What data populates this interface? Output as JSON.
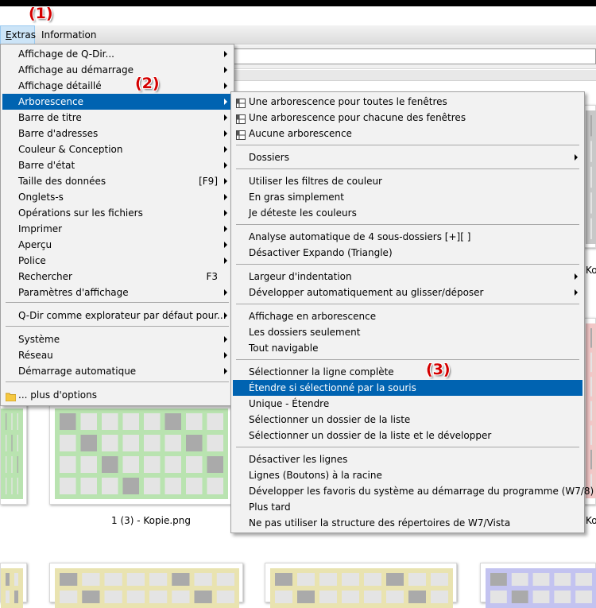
{
  "menubar": {
    "extras_underlined": "E",
    "extras_rest": "xtras",
    "information": "Information"
  },
  "callouts": [
    "(1)",
    "(2)",
    "(3)"
  ],
  "captions": [
    "1 (3) - Kopie.png",
    "Ko",
    "Ko"
  ],
  "extras_menu": {
    "items": [
      {
        "label": "Affichage de Q-Dir...",
        "submenu": true
      },
      {
        "label": "Affichage au démarrage",
        "submenu": true
      },
      {
        "label": "Affichage détaillé",
        "submenu": true
      },
      {
        "label": "Arborescence",
        "submenu": true,
        "highlighted": true
      },
      {
        "label": "Barre de titre",
        "submenu": true
      },
      {
        "label": "Barre d'adresses",
        "submenu": true
      },
      {
        "label": "Couleur & Conception",
        "submenu": true
      },
      {
        "label": "Barre d'état",
        "submenu": true
      },
      {
        "label": "Taille des données",
        "shortcut": "[F9]",
        "submenu": true
      },
      {
        "label": "Onglets-s",
        "submenu": true
      },
      {
        "label": "Opérations sur les fichiers",
        "submenu": true
      },
      {
        "label": "Imprimer",
        "submenu": true
      },
      {
        "label": "Aperçu",
        "submenu": true
      },
      {
        "label": "Police",
        "submenu": true
      },
      {
        "label": "Rechercher",
        "shortcut": "F3"
      },
      {
        "label": "Paramètres d'affichage",
        "submenu": true
      },
      {
        "label": "Q-Dir comme explorateur par défaut pour...",
        "submenu": true
      },
      {
        "label": "Système",
        "submenu": true
      },
      {
        "label": "Réseau",
        "submenu": true
      },
      {
        "label": "Démarrage automatique",
        "submenu": true
      },
      {
        "label": "... plus d'options",
        "icon": "folder-icon"
      }
    ]
  },
  "tree_menu": {
    "items": [
      {
        "label": "Une arborescence pour toutes le fenêtres",
        "icon": "layout-grid-icon"
      },
      {
        "label": "Une arborescence pour chacune des fenêtres",
        "icon": "layout-grid-icon"
      },
      {
        "label": "Aucune arborescence",
        "icon": "layout-grid-icon"
      },
      {
        "label": "Dossiers",
        "submenu": true
      },
      {
        "label": "Utiliser les filtres de couleur"
      },
      {
        "label": "En gras simplement"
      },
      {
        "label": "Je déteste les couleurs"
      },
      {
        "label": "Analyse automatique de 4 sous-dossiers [+][ ]"
      },
      {
        "label": "Désactiver Expando (Triangle)"
      },
      {
        "label": "Largeur d'indentation",
        "submenu": true
      },
      {
        "label": "Développer automatiquement au glisser/déposer",
        "submenu": true
      },
      {
        "label": "Affichage en arborescence"
      },
      {
        "label": "Les dossiers seulement"
      },
      {
        "label": "Tout navigable"
      },
      {
        "label": "Sélectionner la ligne complète"
      },
      {
        "label": "Étendre si sélectionné par la souris",
        "highlighted": true
      },
      {
        "label": "Unique - Étendre"
      },
      {
        "label": "Sélectionner un dossier de la liste"
      },
      {
        "label": "Sélectionner un dossier de la liste et le développer"
      },
      {
        "label": "Désactiver les lignes"
      },
      {
        "label": "Lignes (Boutons) à la racine"
      },
      {
        "label": "Développer les favoris du système au démarrage du programme (W7/8)"
      },
      {
        "label": "Plus tard"
      },
      {
        "label": "Ne pas utiliser la structure des répertoires de W7/Vista"
      }
    ]
  },
  "colors": {
    "highlight": "#0063b1",
    "callout": "#d40000",
    "menu_bg": "#f2f2f2",
    "thumb_green": "#b9e3b0",
    "thumb_yellow": "#e9e3b0",
    "thumb_purple": "#c3c3f0",
    "thumb_gray": "#c8c8c8",
    "thumb_pink": "#f2c7c7"
  }
}
